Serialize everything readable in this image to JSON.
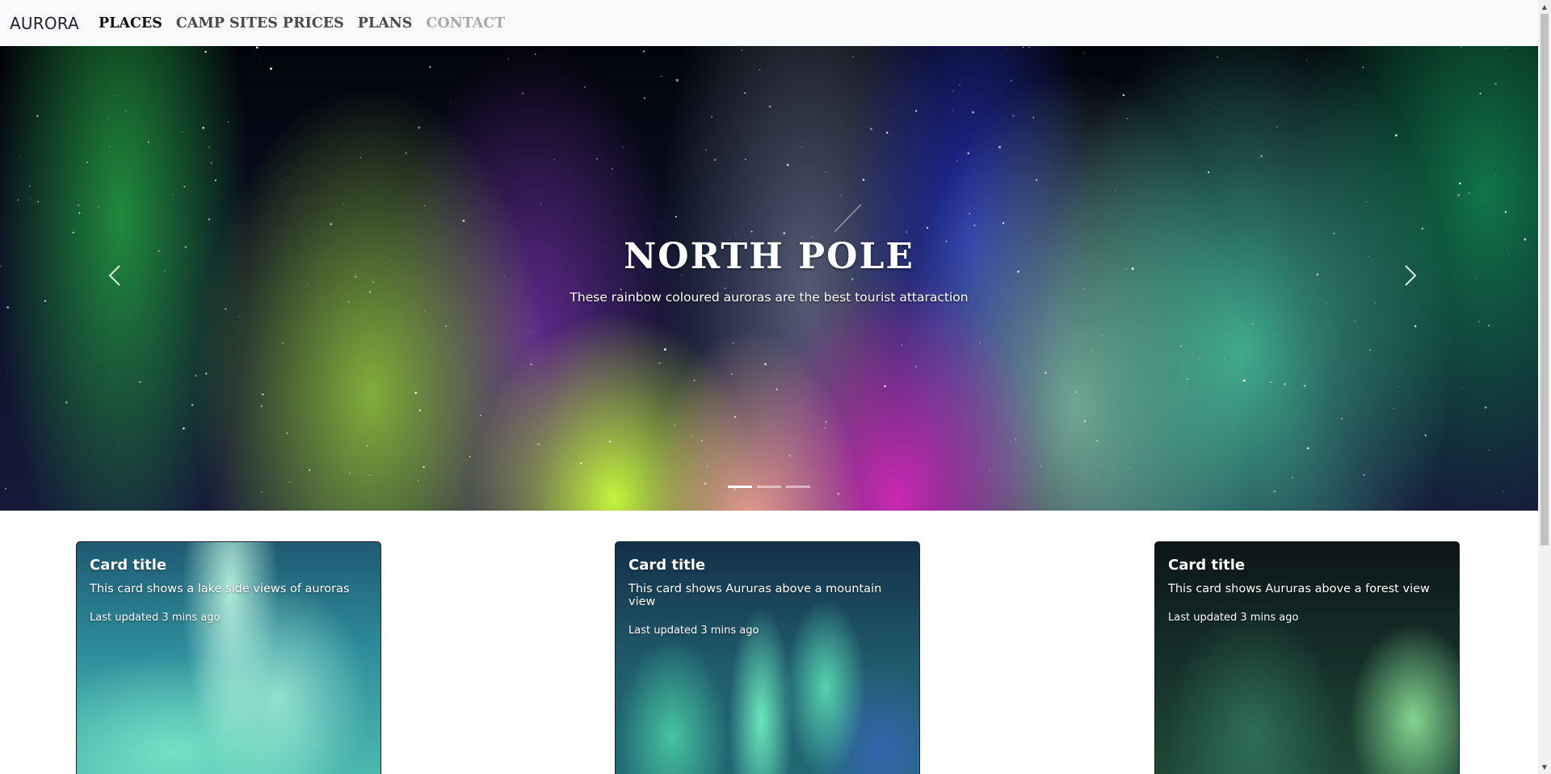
{
  "navbar": {
    "brand": "AURORA",
    "links": [
      {
        "label": "PLACES",
        "state": "active"
      },
      {
        "label": "CAMP SITES PRICES",
        "state": "normal"
      },
      {
        "label": "PLANS",
        "state": "normal"
      },
      {
        "label": "CONTACT",
        "state": "disabled"
      }
    ]
  },
  "hero": {
    "title": "NORTH POLE",
    "text": "These rainbow coloured auroras are the best tourist attaraction",
    "prev_icon": "chevron-left-icon",
    "next_icon": "chevron-right-icon",
    "slide_count": 3,
    "active_slide": 1
  },
  "cards": [
    {
      "title": "Card title",
      "text": "This card shows a lake side views of auroras",
      "updated": "Last updated 3 mins ago"
    },
    {
      "title": "Card title",
      "text": "This card shows Aururas above a mountain view",
      "updated": "Last updated 3 mins ago"
    },
    {
      "title": "Card title",
      "text": "This card shows Aururas above a forest view",
      "updated": "Last updated 3 mins ago"
    }
  ],
  "scrollbar": {
    "up_icon": "scroll-up-arrow-icon",
    "down_icon": "scroll-down-arrow-icon"
  }
}
